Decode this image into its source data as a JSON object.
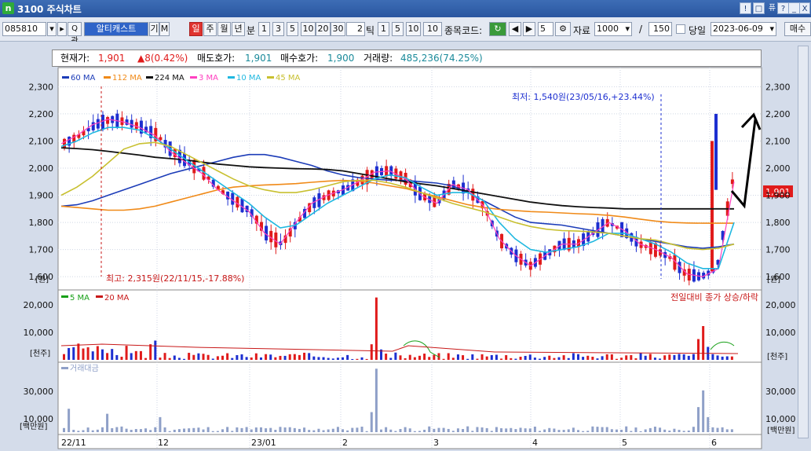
{
  "window": {
    "title": "3100 주식차트",
    "icon_letter": "n",
    "buttons": [
      "!",
      "□",
      "퓨",
      "?",
      "_",
      "□",
      "X"
    ]
  },
  "toolbar": {
    "stock_code": "085810",
    "stock_name": "알티캐스트",
    "search_label": "Q",
    "kwan_label": "관",
    "gi_label": "기",
    "m_label": "M",
    "period_buttons": [
      "일",
      "주",
      "월",
      "년"
    ],
    "bun_label": "분",
    "minute_buttons": [
      "1",
      "3",
      "5",
      "10",
      "20",
      "30"
    ],
    "tick_value": "2",
    "tick_label": "틱",
    "tick_buttons": [
      "1",
      "5",
      "10",
      "10"
    ],
    "code_label": "종목코드:",
    "count_value": "5",
    "data_label": "자료",
    "data_count": "1000",
    "slash": "/",
    "page_value": "150",
    "today_label": "당일",
    "date_value": "2023-06-09",
    "right_label": "매수"
  },
  "price_bar": {
    "current_label": "현재가:",
    "current_value": "1,901",
    "change": "▲8(0.42%)",
    "ask_label": "매도호가:",
    "ask_value": "1,901",
    "bid_label": "매수호가:",
    "bid_value": "1,900",
    "volume_label": "거래량:",
    "volume_value": "485,236(74.25%)"
  },
  "colors": {
    "up": "#e01b1b",
    "down": "#1d2fd0",
    "ma60": "#1c3cb8",
    "ma112": "#f08a18",
    "ma224": "#101010",
    "ma3": "#ff40c0",
    "ma10": "#20b8e0",
    "ma45": "#c8c030",
    "vol_ma5": "#18a018",
    "vol_ma20": "#c81818",
    "amount": "#8fa0c8"
  },
  "chart_data": [
    {
      "type": "candlestick",
      "series": [
        {
          "name": "60 MA",
          "values": [
            1860,
            1865,
            1880,
            1900,
            1920,
            1940,
            1960,
            1980,
            1995,
            2010,
            2025,
            2040,
            2050,
            2050,
            2040,
            2025,
            2010,
            1990,
            1975,
            1965,
            1960,
            1955,
            1955,
            1950,
            1945,
            1935,
            1910,
            1880,
            1850,
            1820,
            1800,
            1795,
            1790,
            1780,
            1770,
            1760,
            1750,
            1740,
            1730,
            1720,
            1710,
            1705,
            1710,
            1720
          ]
        },
        {
          "name": "112 MA",
          "values": [
            1860,
            1855,
            1850,
            1845,
            1845,
            1850,
            1860,
            1875,
            1890,
            1905,
            1920,
            1930,
            1935,
            1938,
            1940,
            1943,
            1948,
            1952,
            1955,
            1952,
            1945,
            1935,
            1925,
            1910,
            1895,
            1880,
            1865,
            1855,
            1848,
            1844,
            1840,
            1838,
            1835,
            1832,
            1830,
            1826,
            1820,
            1812,
            1805,
            1800,
            1798,
            1797,
            1797,
            1797
          ]
        },
        {
          "name": "224 MA",
          "values": [
            2075,
            2072,
            2068,
            2062,
            2055,
            2048,
            2040,
            2035,
            2030,
            2022,
            2015,
            2010,
            2005,
            2002,
            2000,
            1998,
            1997,
            1995,
            1990,
            1980,
            1970,
            1960,
            1950,
            1942,
            1935,
            1925,
            1915,
            1905,
            1895,
            1885,
            1875,
            1868,
            1862,
            1858,
            1855,
            1853,
            1850,
            1850,
            1850,
            1850,
            1850,
            1850,
            1850,
            1850
          ]
        },
        {
          "name": "3 MA",
          "values": [
            2090,
            2120,
            2160,
            2180,
            2170,
            2150,
            2120,
            2060,
            2020,
            1980,
            1920,
            1880,
            1840,
            1760,
            1720,
            1800,
            1870,
            1900,
            1920,
            1950,
            1985,
            1990,
            1960,
            1900,
            1870,
            1940,
            1920,
            1860,
            1740,
            1680,
            1640,
            1680,
            1720,
            1720,
            1760,
            1800,
            1770,
            1720,
            1700,
            1670,
            1610,
            1600,
            1630,
            1950
          ]
        },
        {
          "name": "10 MA",
          "values": [
            2080,
            2100,
            2130,
            2150,
            2150,
            2140,
            2110,
            2070,
            2030,
            1990,
            1950,
            1910,
            1870,
            1820,
            1780,
            1790,
            1830,
            1870,
            1900,
            1930,
            1960,
            1975,
            1965,
            1930,
            1900,
            1910,
            1910,
            1880,
            1800,
            1740,
            1700,
            1690,
            1700,
            1710,
            1730,
            1760,
            1760,
            1740,
            1720,
            1690,
            1650,
            1630,
            1630,
            1800
          ]
        },
        {
          "name": "45 MA",
          "values": [
            1900,
            1930,
            1970,
            2020,
            2070,
            2090,
            2095,
            2080,
            2050,
            2020,
            1990,
            1960,
            1935,
            1920,
            1910,
            1910,
            1920,
            1935,
            1950,
            1955,
            1955,
            1945,
            1930,
            1910,
            1890,
            1870,
            1855,
            1840,
            1820,
            1800,
            1785,
            1775,
            1770,
            1768,
            1765,
            1760,
            1750,
            1740,
            1735,
            1720,
            1705,
            1700,
            1705,
            1720
          ]
        }
      ],
      "ylim": [
        1560,
        2330
      ],
      "yticks": [
        "2,300",
        "2,200",
        "2,100",
        "2,000",
        "1,900",
        "1,800",
        "1,700",
        "1,600"
      ],
      "yunit": "[원]",
      "last_price_label": "1,901",
      "annotations": {
        "low": "최저: 1,540원(23/05/16,+23.44%)",
        "high": "최고: 2,315원(22/11/15,-17.88%)"
      }
    },
    {
      "type": "bar",
      "series": [
        {
          "name": "5 MA",
          "values": []
        },
        {
          "name": "20 MA",
          "values": []
        }
      ],
      "title": "전일대비 종가 상승/하락",
      "yticks": [
        "20,000",
        "10,000"
      ],
      "yunit": "[천주]",
      "ylim": [
        0,
        26000
      ]
    },
    {
      "type": "bar",
      "series": [
        {
          "name": "거래대금",
          "values": []
        }
      ],
      "yticks": [
        "30,000",
        "10,000"
      ],
      "yunit": "[백만원]",
      "ylim": [
        0,
        40000
      ]
    }
  ],
  "x_axis": {
    "labels": [
      "22/11",
      "12",
      "23/01",
      "2",
      "3",
      "4",
      "5",
      "6"
    ]
  }
}
